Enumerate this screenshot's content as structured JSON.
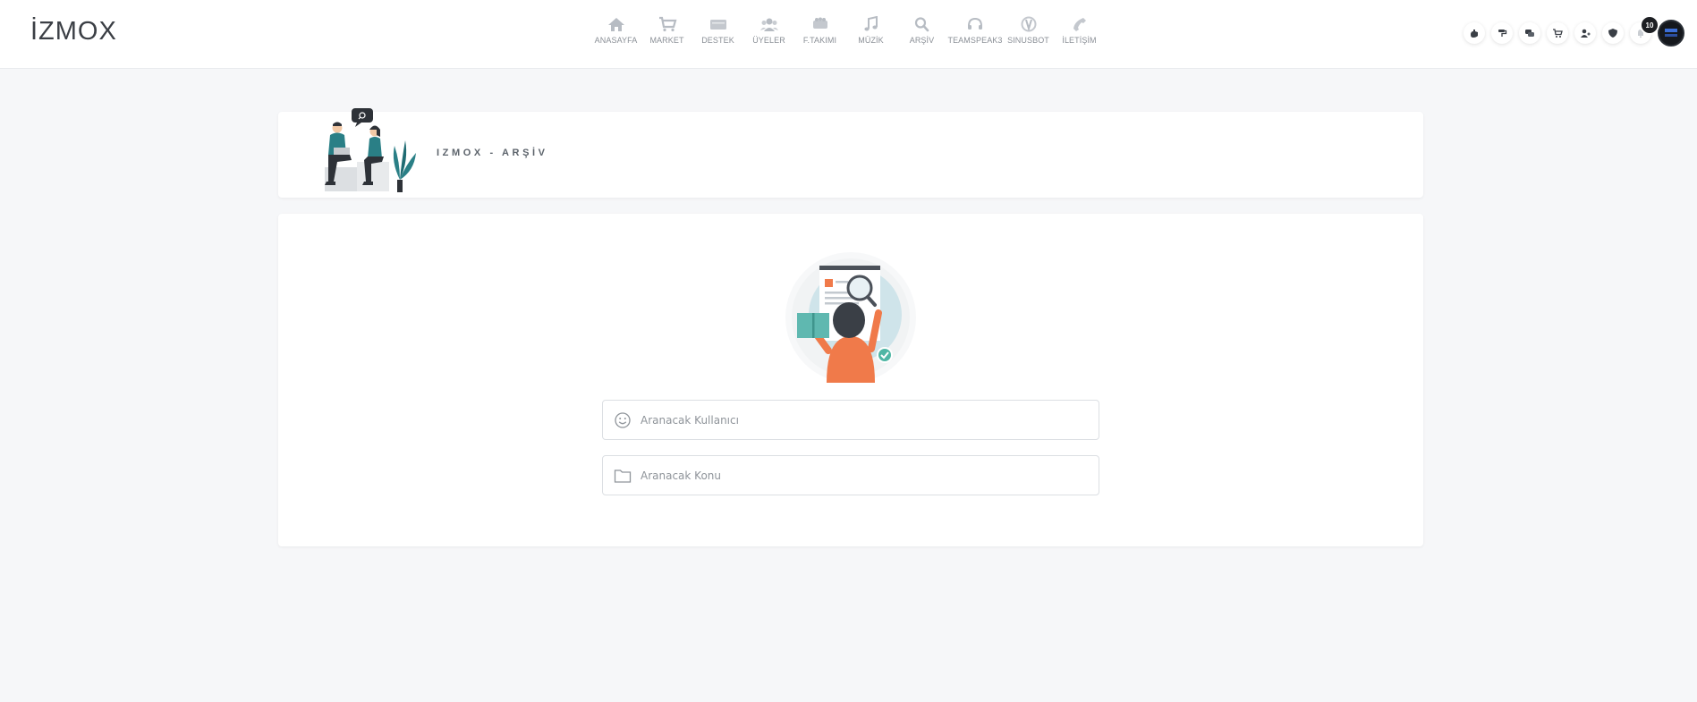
{
  "brand": {
    "logo_text": "İZMOX"
  },
  "nav": {
    "items": [
      {
        "label": "ANASAYFA",
        "icon": "home-icon"
      },
      {
        "label": "MARKET",
        "icon": "cart-icon"
      },
      {
        "label": "DESTEK",
        "icon": "ticket-icon"
      },
      {
        "label": "ÜYELER",
        "icon": "users-icon"
      },
      {
        "label": "F.TAKIMI",
        "icon": "team-icon"
      },
      {
        "label": "MÜZİK",
        "icon": "music-icon"
      },
      {
        "label": "ARŞİV",
        "icon": "search-icon"
      },
      {
        "label": "TEAMSPEAK3",
        "icon": "headset-icon"
      },
      {
        "label": "SINUSBOT",
        "icon": "bot-icon"
      },
      {
        "label": "İLETİŞİM",
        "icon": "phone-icon"
      }
    ]
  },
  "userbar": {
    "icons": [
      "hand-icon",
      "paint-roller-icon",
      "chat-icon",
      "cart-icon",
      "user-settings-icon",
      "shield-icon",
      "bell-icon"
    ],
    "notification_count": "10"
  },
  "page": {
    "header_title": "IZMOX - ARŞİV"
  },
  "search": {
    "user_placeholder": "Aranacak Kullanıcı",
    "topic_placeholder": "Aranacak Konu"
  },
  "colors": {
    "accent_teal": "#2a7f86",
    "accent_orange": "#f07a4a",
    "text_muted": "#8a8f96"
  }
}
